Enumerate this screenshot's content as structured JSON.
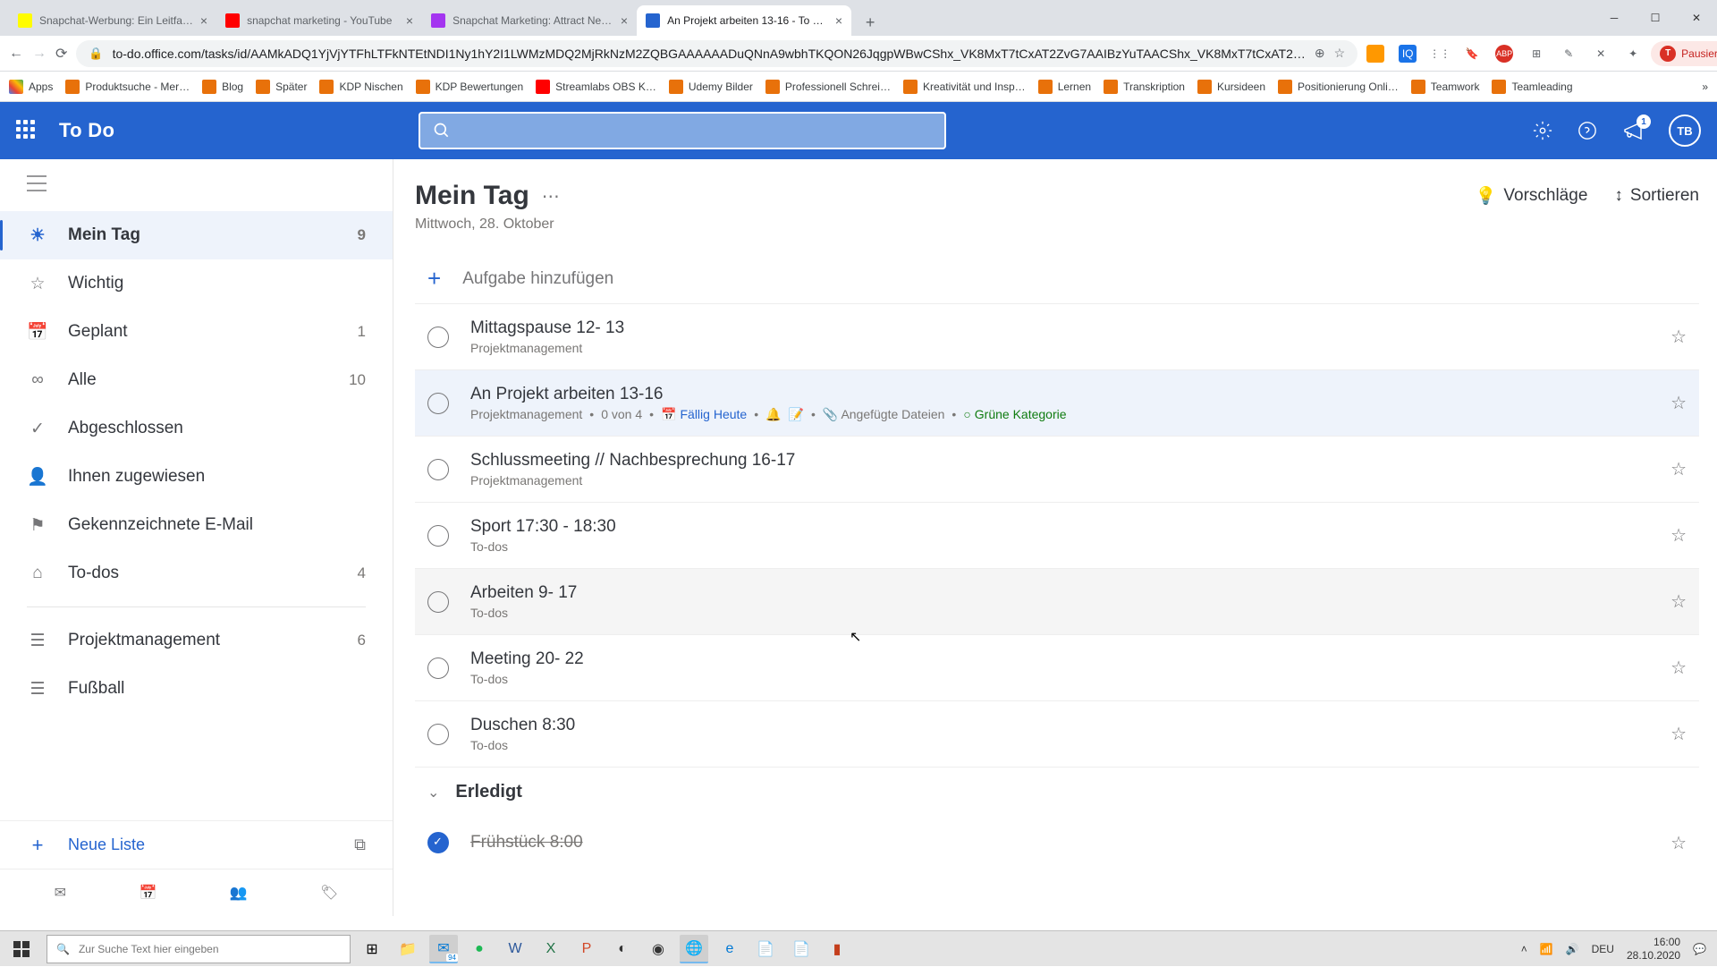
{
  "browser": {
    "tabs": [
      {
        "title": "Snapchat-Werbung: Ein Leitfa…",
        "favicon": "#fffc00"
      },
      {
        "title": "snapchat marketing - YouTube",
        "favicon": "#ff0000"
      },
      {
        "title": "Snapchat Marketing: Attract New…",
        "favicon": "#a435f0"
      },
      {
        "title": "An Projekt arbeiten 13-16 - To D…",
        "favicon": "#2564cf",
        "active": true
      }
    ],
    "url": "to-do.office.com/tasks/id/AAMkADQ1YjVjYTFhLTFkNTEtNDI1Ny1hY2I1LWMzMDQ2MjRkNzM2ZQBGAAAAAADuQNnA9wbhTKQON26JqgpWBwCShx_VK8MxT7tCxAT2ZvG7AAIBzYuTAACShx_VK8MxT7tCxAT2…",
    "profile_status": "Pausiert",
    "bookmarks": [
      {
        "label": "Apps",
        "color": "#5f6368"
      },
      {
        "label": "Produktsuche - Mer…",
        "color": "#e8710a"
      },
      {
        "label": "Blog",
        "color": "#e8710a"
      },
      {
        "label": "Später",
        "color": "#e8710a"
      },
      {
        "label": "KDP Nischen",
        "color": "#e8710a"
      },
      {
        "label": "KDP Bewertungen",
        "color": "#e8710a"
      },
      {
        "label": "Streamlabs OBS K…",
        "color": "#ff0000"
      },
      {
        "label": "Udemy Bilder",
        "color": "#e8710a"
      },
      {
        "label": "Professionell Schrei…",
        "color": "#e8710a"
      },
      {
        "label": "Kreativität und Insp…",
        "color": "#e8710a"
      },
      {
        "label": "Lernen",
        "color": "#e8710a"
      },
      {
        "label": "Transkription",
        "color": "#e8710a"
      },
      {
        "label": "Kursideen",
        "color": "#e8710a"
      },
      {
        "label": "Positionierung Onli…",
        "color": "#e8710a"
      },
      {
        "label": "Teamwork",
        "color": "#e8710a"
      },
      {
        "label": "Teamleading",
        "color": "#e8710a"
      }
    ]
  },
  "header": {
    "app_name": "To Do",
    "notification_count": "1",
    "avatar": "TB"
  },
  "sidebar": {
    "items": [
      {
        "icon": "sun",
        "label": "Mein Tag",
        "count": "9",
        "active": true
      },
      {
        "icon": "star",
        "label": "Wichtig",
        "count": ""
      },
      {
        "icon": "calendar",
        "label": "Geplant",
        "count": "1"
      },
      {
        "icon": "infinity",
        "label": "Alle",
        "count": "10"
      },
      {
        "icon": "check",
        "label": "Abgeschlossen",
        "count": ""
      },
      {
        "icon": "user",
        "label": "Ihnen zugewiesen",
        "count": ""
      },
      {
        "icon": "flag",
        "label": "Gekennzeichnete E-Mail",
        "count": ""
      },
      {
        "icon": "home",
        "label": "To-dos",
        "count": "4"
      }
    ],
    "lists": [
      {
        "label": "Projektmanagement",
        "count": "6"
      },
      {
        "label": "Fußball",
        "count": ""
      }
    ],
    "new_list": "Neue Liste"
  },
  "main": {
    "title": "Mein Tag",
    "date": "Mittwoch, 28. Oktober",
    "suggestions": "Vorschläge",
    "sort": "Sortieren",
    "add_placeholder": "Aufgabe hinzufügen",
    "completed_header": "Erledigt",
    "tasks": [
      {
        "title": "Mittagspause 12- 13",
        "meta_list": "Projektmanagement"
      },
      {
        "title": "An Projekt arbeiten 13-16",
        "meta_list": "Projektmanagement",
        "progress": "0 von 4",
        "due": "Fällig Heute",
        "attach": "Angefügte Dateien",
        "category": "Grüne Kategorie",
        "selected": true
      },
      {
        "title": "Schlussmeeting // Nachbesprechung 16-17",
        "meta_list": "Projektmanagement"
      },
      {
        "title": "Sport 17:30 - 18:30",
        "meta_list": "To-dos"
      },
      {
        "title": "Arbeiten 9- 17",
        "meta_list": "To-dos",
        "hover": true
      },
      {
        "title": "Meeting 20- 22",
        "meta_list": "To-dos"
      },
      {
        "title": "Duschen 8:30",
        "meta_list": "To-dos"
      }
    ],
    "done_tasks": [
      {
        "title": "Frühstück 8:00"
      }
    ]
  },
  "taskbar": {
    "search_placeholder": "Zur Suche Text hier eingeben",
    "mail_badge": "94",
    "lang": "DEU",
    "time": "16:00",
    "date": "28.10.2020"
  }
}
